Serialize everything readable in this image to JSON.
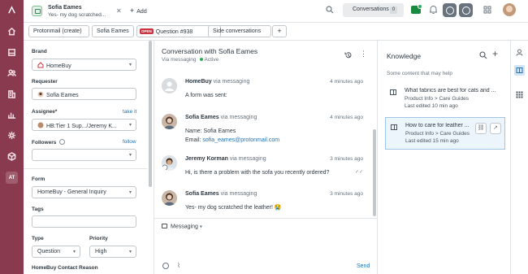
{
  "rail": {
    "icons": [
      "zendesk-logo-icon",
      "home-icon",
      "views-icon",
      "customers-icon",
      "organizations-icon",
      "reporting-icon",
      "admin-gear-icon",
      "apps-cube-icon"
    ],
    "user_initials": "AT"
  },
  "topbar": {
    "ticket_tab": {
      "name": "Sofia Eames",
      "subtitle": "Yes- my dog scratched..."
    },
    "add_label": "Add",
    "conversations_label": "Conversations",
    "conversations_count": "0"
  },
  "subbar": {
    "crumbs": [
      "Protonmail (create)",
      "Sofia Eames",
      "Question #938",
      "Side conversations"
    ],
    "status_badge": "OPEN",
    "add_label": "+"
  },
  "properties": {
    "brand_label": "Brand",
    "brand_value": "HomeBuy",
    "requester_label": "Requester",
    "requester_value": "Sofia Eames",
    "assignee_label": "Assignee*",
    "take_it": "take it",
    "assignee_value": "HB:Tier 1 Sup.../Jeremy K...",
    "followers_label": "Followers",
    "follow_link": "follow",
    "form_label": "Form",
    "form_value": "HomeBuy - General Inquiry",
    "tags_label": "Tags",
    "type_label": "Type",
    "type_value": "Question",
    "priority_label": "Priority",
    "priority_value": "High",
    "contact_reason_label": "HomeBuy Contact Reason"
  },
  "conversation": {
    "title": "Conversation with Sofia Eames",
    "channel": "Via messaging",
    "status": "Active",
    "messages": [
      {
        "author": "HomeBuy",
        "via": "via messaging",
        "time": "4 minutes ago",
        "lines": [
          "A form was sent:"
        ]
      },
      {
        "author": "Sofia Eames",
        "via": "via messaging",
        "time": "4 minutes ago",
        "lines": [
          "Name: Sofia Eames",
          "Email: "
        ],
        "email": "sofia_eames@protonmail.com"
      },
      {
        "author": "Jeremy Korman",
        "via": "via messaging",
        "time": "3 minutes ago",
        "lines": [
          "Hi, is there a problem with the sofa you recently ordered?"
        ]
      },
      {
        "author": "Sofia Eames",
        "via": "via messaging",
        "time": "3 minutes ago",
        "lines": [
          "Yes- my dog scratched the leather! 😭"
        ]
      }
    ],
    "compose_channel": "Messaging",
    "send_label": "Send"
  },
  "knowledge": {
    "title": "Knowledge",
    "hint": "Some content that may help",
    "articles": [
      {
        "title": "What fabrics are best for cats and ...",
        "path": "Product Info > Care Guides",
        "edited": "Last edited 10 min ago"
      },
      {
        "title": "How to care for leather ...",
        "path": "Product Info > Care Guides",
        "edited": "Last edited 15 min ago"
      }
    ]
  },
  "colors": {
    "rail": "#8a3a4f",
    "link": "#1f73b7",
    "active": "#2bb05a",
    "open_badge": "#cc3340",
    "selected_card": "#edf5fc"
  }
}
